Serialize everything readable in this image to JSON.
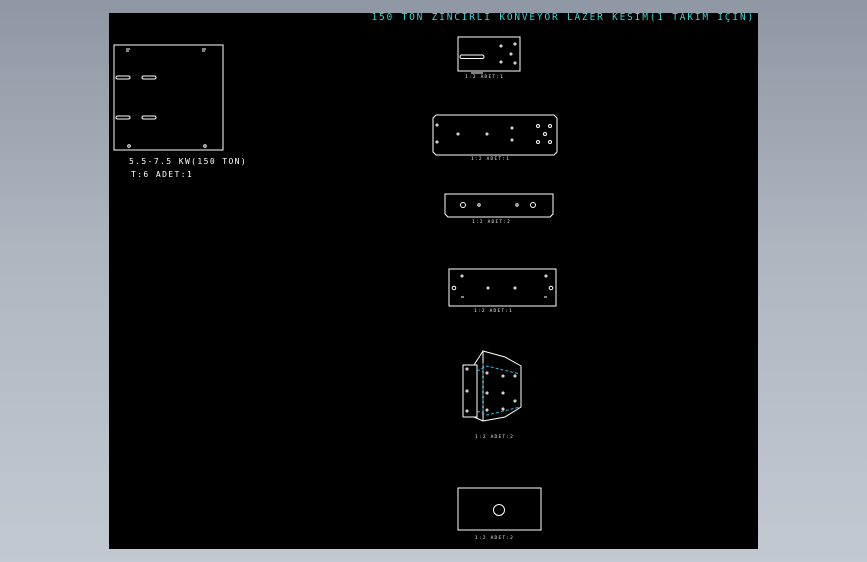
{
  "drawing": {
    "title": "150 TON ZİNCİRLİ KONVEYÖR LAZER KESİM(1 TAKIM İÇİN)",
    "motor_label": "5.5-7.5 KW(150 TON)",
    "part_label": "T:6  ADET:1",
    "part_captions": [
      "1:2   ADET:1",
      "1:2   ADET:1",
      "1:2   ADET:2",
      "1:2   ADET:1",
      "1:2   ADET:2",
      "1:2   ADET:2"
    ]
  },
  "colors": {
    "background": "#000000",
    "linework": "#ffffff",
    "title": "#35d6d6",
    "bend_lines": "#2fb7d8"
  }
}
